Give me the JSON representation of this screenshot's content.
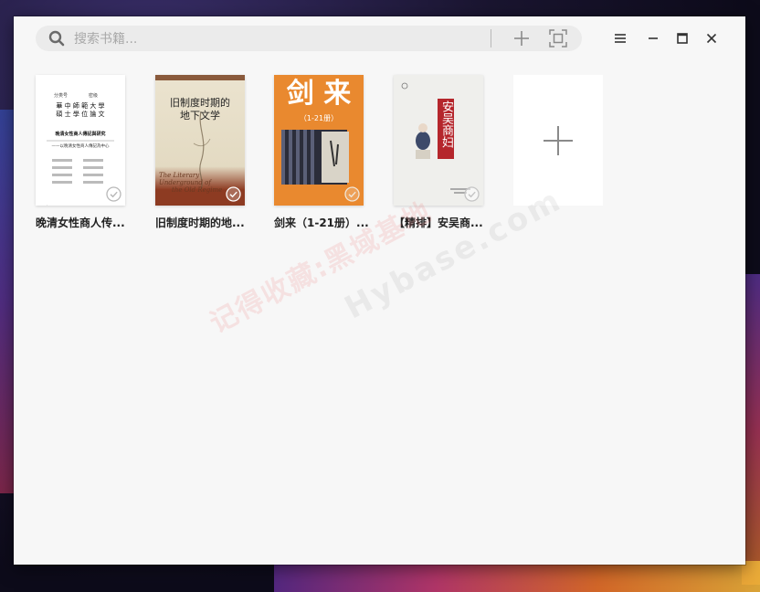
{
  "search": {
    "placeholder": "搜索书籍..."
  },
  "toolbar": {
    "add_icon": "plus-icon",
    "scan_icon": "scan-icon",
    "menu_icon": "hamburger-menu-icon",
    "minimize_icon": "minimize-icon",
    "maximize_icon": "maximize-icon",
    "close_icon": "close-icon"
  },
  "books": [
    {
      "title": "晚清女性商人传...",
      "cover": {
        "line1": "華 中 師 範 大 學",
        "line2": "碩 士 學 位 論 文",
        "heading": "晚清女性商人傳記與研究",
        "sub": "——以晚清女性商人傳記為中心"
      }
    },
    {
      "title": "旧制度时期的地...",
      "cover": {
        "title_line1": "旧制度时期的",
        "title_line2": "地下文学",
        "en_line1": "The Literary Underground of",
        "en_line2": "the Old Regime"
      }
    },
    {
      "title": "剑来（1-21册）...",
      "cover": {
        "big_title": "剑 来",
        "subtitle": "（1-21册）"
      }
    },
    {
      "title": "【精排】安吴商...",
      "cover": {
        "vertical_title": "安吴商妇"
      }
    }
  ],
  "watermark": {
    "text_cn": "记得收藏:黑域基地",
    "text_en": "Hybase.com"
  },
  "colors": {
    "window_bg": "#f7f7f7",
    "search_bg": "#ebebeb",
    "icon_gray": "#8a8a8a",
    "cover3_orange": "#e9892f"
  }
}
